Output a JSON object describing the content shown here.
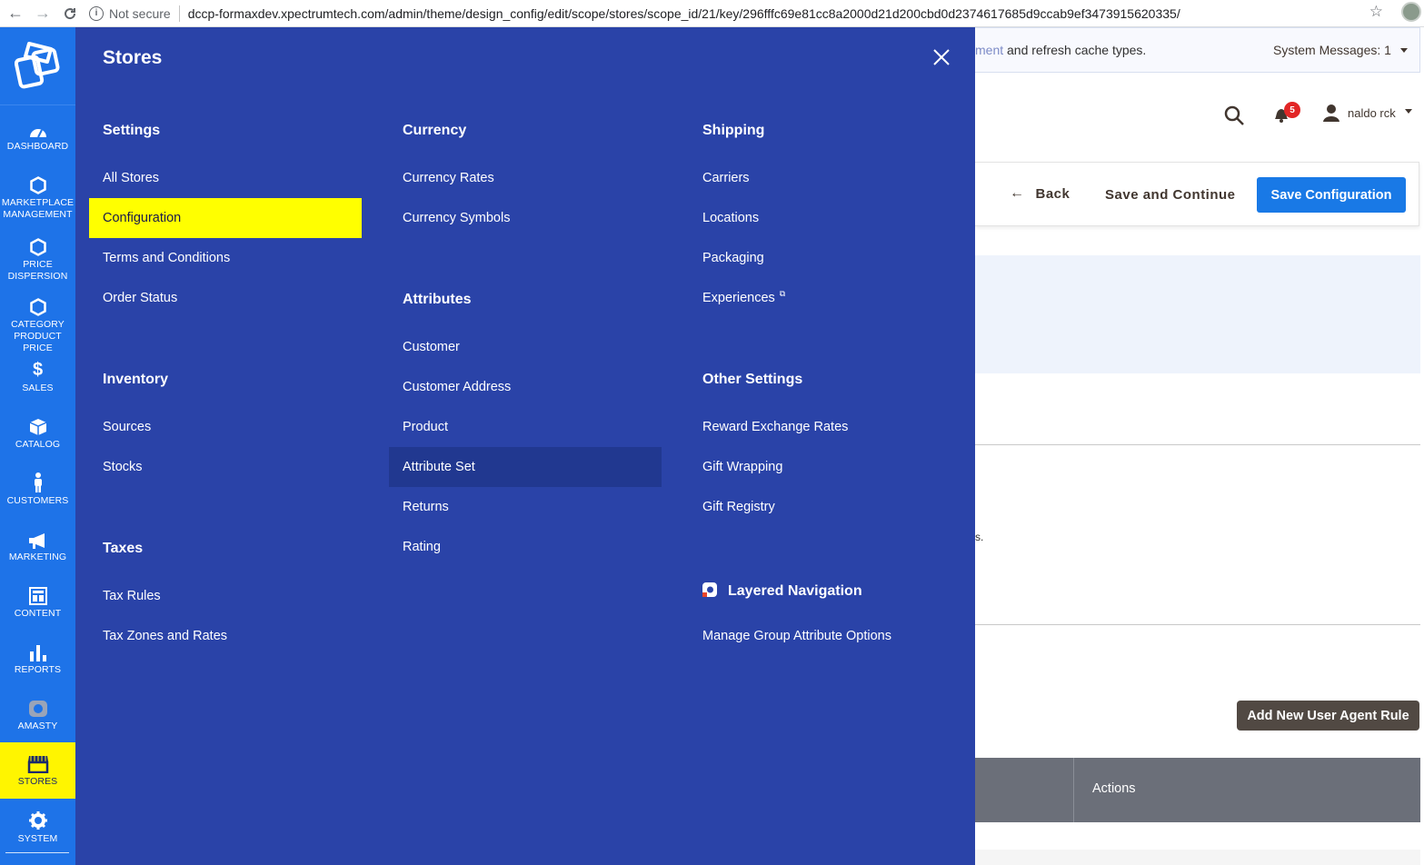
{
  "browser": {
    "security_label": "Not secure",
    "url": "dccp-formaxdev.xpectrumtech.com/admin/theme/design_config/edit/scope/stores/scope_id/21/key/296fffc69e81cc8a2000d21d200cbd0d2374617685d9ccab9ef3473915620335/"
  },
  "admin_nav": {
    "items": [
      {
        "label": "DASHBOARD",
        "icon": "gauge-icon"
      },
      {
        "label": "MARKETPLACE MANAGEMENT",
        "icon": "hexagon-icon"
      },
      {
        "label": "PRICE DISPERSION",
        "icon": "hexagon-icon"
      },
      {
        "label": "CATEGORY PRODUCT PRICE",
        "icon": "hexagon-icon"
      },
      {
        "label": "SALES",
        "icon": "dollar-icon"
      },
      {
        "label": "CATALOG",
        "icon": "cube-icon"
      },
      {
        "label": "CUSTOMERS",
        "icon": "person-icon"
      },
      {
        "label": "MARKETING",
        "icon": "megaphone-icon"
      },
      {
        "label": "CONTENT",
        "icon": "layout-icon"
      },
      {
        "label": "REPORTS",
        "icon": "bar-chart-icon"
      },
      {
        "label": "AMASTY",
        "icon": "amasty-icon"
      },
      {
        "label": "STORES",
        "icon": "store-icon"
      },
      {
        "label": "SYSTEM",
        "icon": "gear-icon"
      }
    ],
    "active": "STORES"
  },
  "stores_menu": {
    "title": "Stores",
    "settings": {
      "title": "Settings",
      "links": [
        "All Stores",
        "Configuration",
        "Terms and Conditions",
        "Order Status"
      ]
    },
    "inventory": {
      "title": "Inventory",
      "links": [
        "Sources",
        "Stocks"
      ]
    },
    "taxes": {
      "title": "Taxes",
      "links": [
        "Tax Rules",
        "Tax Zones and Rates"
      ]
    },
    "currency": {
      "title": "Currency",
      "links": [
        "Currency Rates",
        "Currency Symbols"
      ]
    },
    "attributes": {
      "title": "Attributes",
      "links": [
        "Customer",
        "Customer Address",
        "Product",
        "Attribute Set",
        "Returns",
        "Rating"
      ]
    },
    "shipping": {
      "title": "Shipping",
      "links": [
        "Carriers",
        "Locations",
        "Packaging",
        "Experiences"
      ]
    },
    "other_settings": {
      "title": "Other Settings",
      "links": [
        "Reward Exchange Rates",
        "Gift Wrapping",
        "Gift Registry"
      ]
    },
    "layered_navigation": {
      "title": "Layered Navigation",
      "links": [
        "Manage Group Attribute Options"
      ]
    },
    "highlighted_link": "Configuration",
    "hovered_link": "Attribute Set"
  },
  "page": {
    "system_message_faded": "ment",
    "system_message_text": " and refresh cache types.",
    "system_messages": "System Messages: 1",
    "notification_count": "5",
    "username": "naldo rck",
    "back_label": "Back",
    "save_continue_label": "Save and Continue",
    "save_config_label": "Save Configuration",
    "stray_text": "s.",
    "add_rule_label": "Add New User Agent Rule",
    "table_actions_header": "Actions"
  },
  "colors": {
    "nav_blue": "#1e73e8",
    "panel_blue": "#2a43a8",
    "highlight_yellow": "#ffff00",
    "save_button_blue": "#1979e6"
  }
}
